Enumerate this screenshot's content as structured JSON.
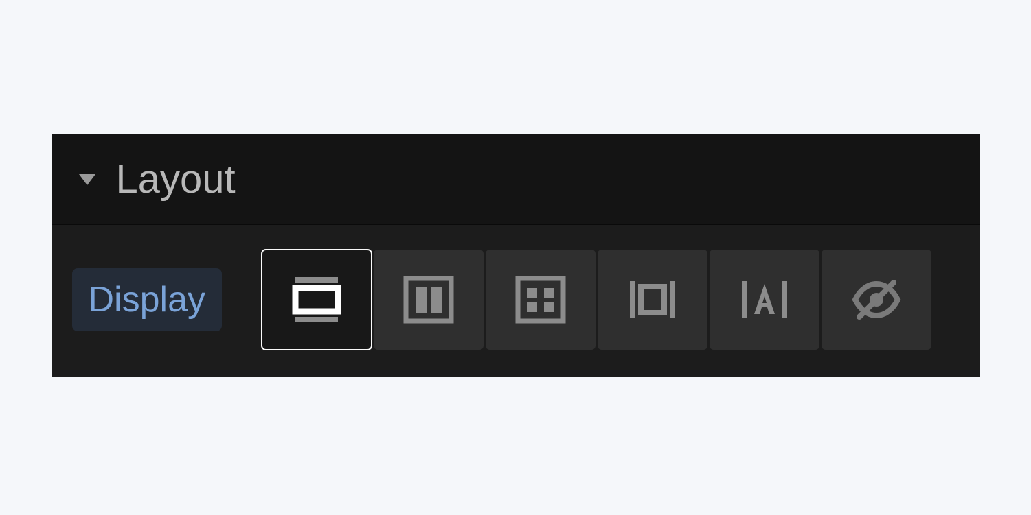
{
  "section": {
    "title": "Layout"
  },
  "property": {
    "label": "Display"
  },
  "options": {
    "selected": 0,
    "items": [
      {
        "name": "block"
      },
      {
        "name": "flex"
      },
      {
        "name": "grid"
      },
      {
        "name": "inline-block"
      },
      {
        "name": "inline"
      },
      {
        "name": "none"
      }
    ]
  }
}
